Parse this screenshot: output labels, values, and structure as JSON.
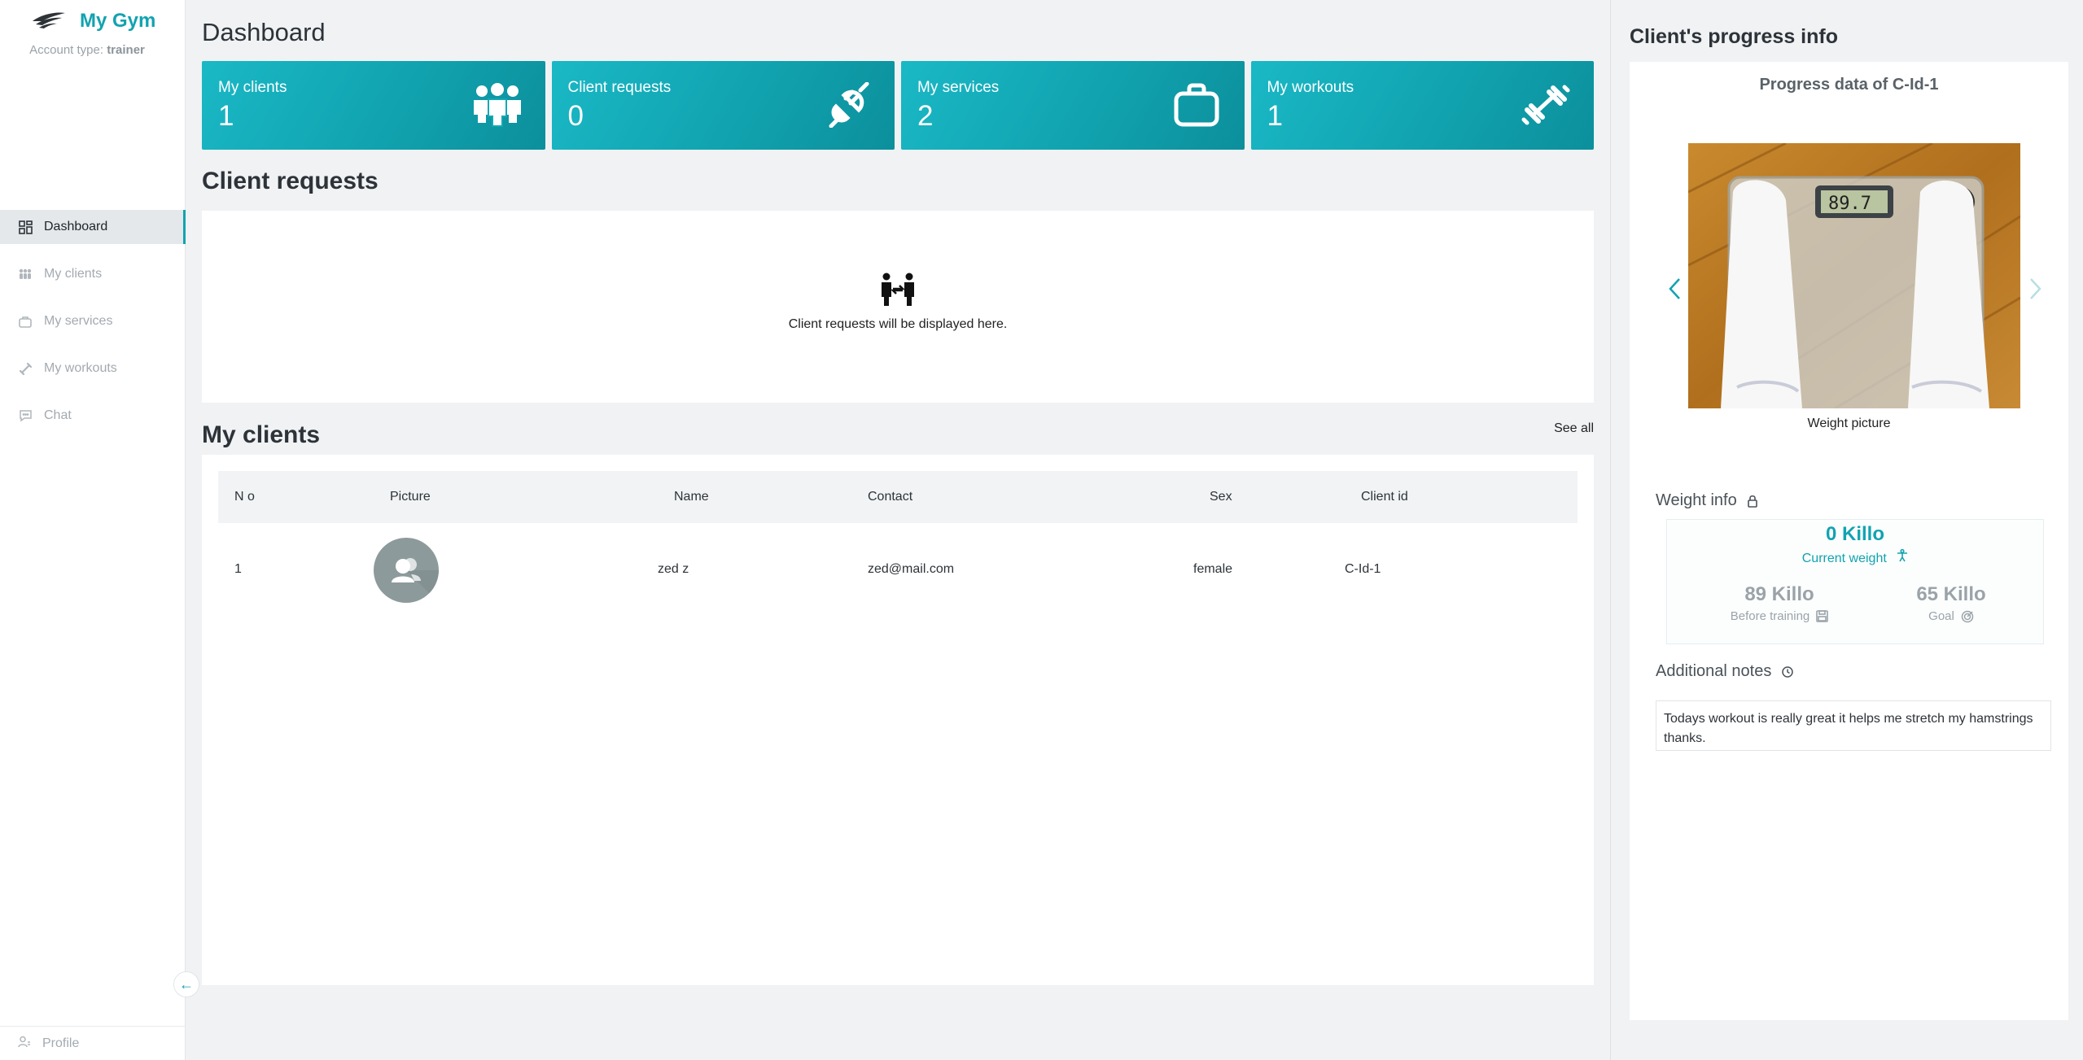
{
  "app": {
    "name": "My Gym",
    "account_type_label": "Account type:",
    "account_type_value": "trainer"
  },
  "sidebar": {
    "items": [
      {
        "label": "Dashboard",
        "icon": "dashboard-icon",
        "active": true
      },
      {
        "label": "My clients",
        "icon": "clients-icon"
      },
      {
        "label": "My services",
        "icon": "services-icon"
      },
      {
        "label": "My workouts",
        "icon": "workouts-icon"
      },
      {
        "label": "Chat",
        "icon": "chat-icon"
      }
    ],
    "profile_label": "Profile",
    "collapse_icon": "arrow-left-icon"
  },
  "dashboard": {
    "title": "Dashboard",
    "cards": [
      {
        "label": "My clients",
        "value": "1",
        "icon": "group-icon"
      },
      {
        "label": "Client requests",
        "value": "0",
        "icon": "plug-icon"
      },
      {
        "label": "My services",
        "value": "2",
        "icon": "briefcase-icon"
      },
      {
        "label": "My workouts",
        "value": "1",
        "icon": "dumbbell-icon"
      }
    ]
  },
  "requests": {
    "title": "Client requests",
    "empty_text": "Client requests will be displayed here."
  },
  "clients": {
    "title": "My clients",
    "see_all": "See all",
    "columns": [
      "N o",
      "Picture",
      "Name",
      "Contact",
      "Sex",
      "Client id"
    ],
    "rows": [
      {
        "no": "1",
        "name": "zed z",
        "contact": "zed@mail.com",
        "sex": "female",
        "client_id": "C-Id-1"
      }
    ]
  },
  "progress": {
    "panel_title": "Client's progress info",
    "data_title": "Progress data of C-Id-1",
    "photo_caption": "Weight picture",
    "scale_reading": "89.7",
    "weight_info_title": "Weight info",
    "current_weight": "0 Killo",
    "current_weight_label": "Current weight",
    "before_weight": "89 Killo",
    "before_label": "Before training",
    "goal_weight": "65 Killo",
    "goal_label": "Goal",
    "notes_title": "Additional notes",
    "notes_text": "Todays workout is really great it helps me stretch my hamstrings thanks."
  },
  "colors": {
    "accent": "#12a3b0",
    "card_start": "#1ab8c6",
    "card_end": "#0c8f9c"
  }
}
